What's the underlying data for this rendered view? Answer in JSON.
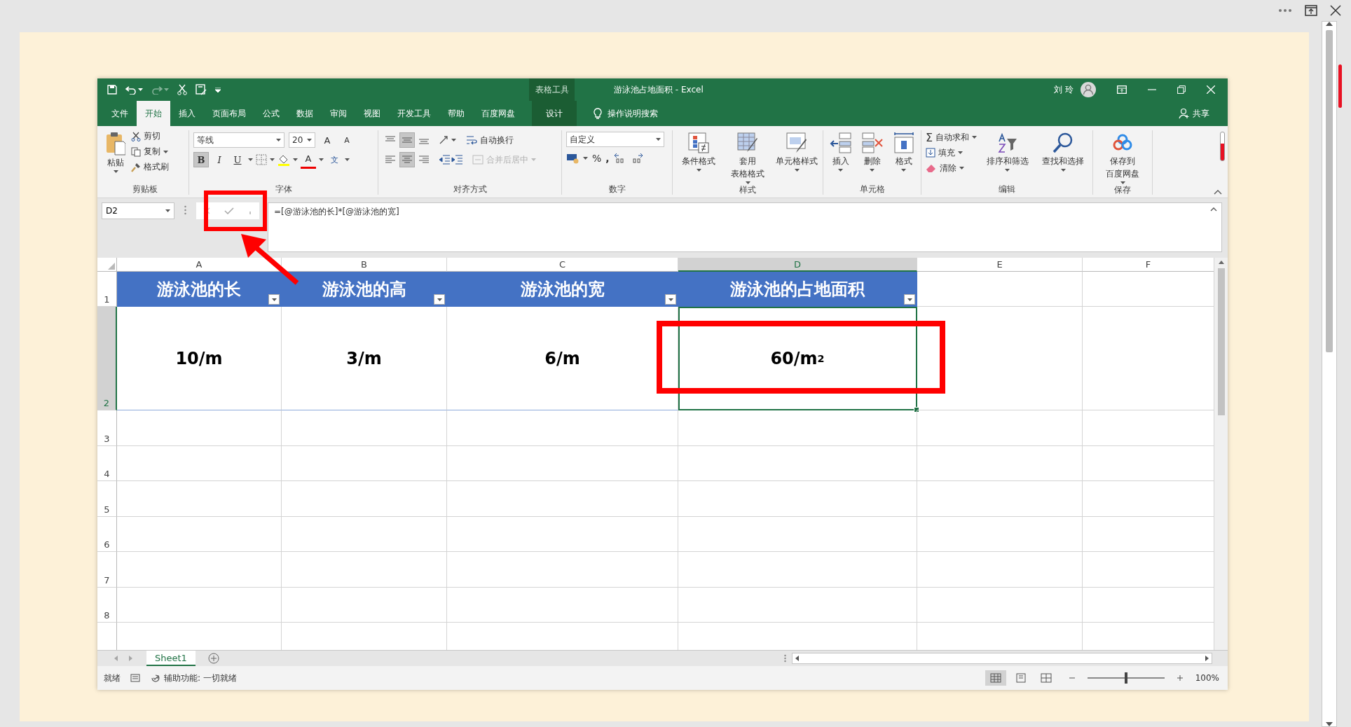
{
  "window": {
    "title": "游泳池占地面积  -  Excel",
    "tool_group": "表格工具",
    "user": "刘 玲"
  },
  "tabs": [
    {
      "label": "文件",
      "selected": false,
      "kind": "normal"
    },
    {
      "label": "开始",
      "selected": true,
      "kind": "normal"
    },
    {
      "label": "插入",
      "selected": false,
      "kind": "normal"
    },
    {
      "label": "页面布局",
      "selected": false,
      "kind": "normal"
    },
    {
      "label": "公式",
      "selected": false,
      "kind": "normal"
    },
    {
      "label": "数据",
      "selected": false,
      "kind": "normal"
    },
    {
      "label": "审阅",
      "selected": false,
      "kind": "normal"
    },
    {
      "label": "视图",
      "selected": false,
      "kind": "normal"
    },
    {
      "label": "开发工具",
      "selected": false,
      "kind": "normal"
    },
    {
      "label": "帮助",
      "selected": false,
      "kind": "normal"
    },
    {
      "label": "百度网盘",
      "selected": false,
      "kind": "normal"
    },
    {
      "label": "设计",
      "selected": false,
      "kind": "context"
    }
  ],
  "tell_me": "操作说明搜索",
  "share": "共享",
  "ribbon": [
    {
      "kind": "clipboard",
      "label": "剪贴板",
      "paste": "粘贴",
      "cut": "剪切",
      "copy": "复制",
      "format_painter": "格式刷"
    },
    {
      "kind": "font",
      "label": "字体",
      "font": "等线",
      "size": "20",
      "grow": "A",
      "shrink": "A",
      "bold": {
        "label": "B",
        "selected": true
      },
      "italic": {
        "label": "I",
        "selected": false
      },
      "underline": {
        "label": "U",
        "selected": false
      },
      "font_color": "A",
      "phonetic": "文"
    },
    {
      "kind": "alignment",
      "label": "对齐方式",
      "vertical": [
        {
          "selected": false
        },
        {
          "selected": true
        },
        {
          "selected": false
        }
      ],
      "horizontal": [
        {
          "selected": false
        },
        {
          "selected": true
        },
        {
          "selected": false
        }
      ],
      "wrap": "自动换行",
      "merge": {
        "label": "合并后居中",
        "disabled": true
      }
    },
    {
      "kind": "number",
      "label": "数字",
      "format": "自定义",
      "percent": "%",
      "comma": ","
    },
    {
      "kind": "large",
      "label": "样式",
      "buttons": [
        {
          "lines": [
            "条件格式"
          ],
          "kind": "conditional"
        },
        {
          "lines": [
            "套用",
            "表格格式"
          ],
          "kind": "table"
        },
        {
          "lines": [
            "单元格样式"
          ],
          "kind": "cellstyle"
        }
      ]
    },
    {
      "kind": "large",
      "label": "单元格",
      "buttons": [
        {
          "lines": [
            "插入"
          ],
          "kind": "insert"
        },
        {
          "lines": [
            "删除"
          ],
          "kind": "delete"
        },
        {
          "lines": [
            "格式"
          ],
          "kind": "format"
        }
      ]
    },
    {
      "kind": "editing",
      "label": "编辑",
      "sum_sign": "Σ",
      "small": [
        "自动求和",
        "填充",
        "清除"
      ],
      "buttons": [
        {
          "lines": [
            "排序和筛选"
          ],
          "kind": "sort"
        },
        {
          "lines": [
            "查找和选择"
          ],
          "kind": "find"
        }
      ]
    },
    {
      "kind": "large",
      "label": "保存",
      "buttons": [
        {
          "lines": [
            "保存到",
            "百度网盘"
          ],
          "kind": "cloud"
        }
      ]
    }
  ],
  "formula_bar": {
    "name_box": "D2",
    "formula": "=[@游泳池的长]*[@游泳池的宽]"
  },
  "columns": [
    {
      "label": "A",
      "selected": false
    },
    {
      "label": "B",
      "selected": false
    },
    {
      "label": "C",
      "selected": false
    },
    {
      "label": "D",
      "selected": true
    },
    {
      "label": "E",
      "selected": false
    },
    {
      "label": "F",
      "selected": false
    }
  ],
  "rows": [
    {
      "label": "1",
      "selected": false
    },
    {
      "label": "2",
      "selected": true
    },
    {
      "label": "3",
      "selected": false
    },
    {
      "label": "4",
      "selected": false
    },
    {
      "label": "5",
      "selected": false
    },
    {
      "label": "6",
      "selected": false
    },
    {
      "label": "7",
      "selected": false
    },
    {
      "label": "8",
      "selected": false
    }
  ],
  "table": {
    "headers": [
      "游泳池的长",
      "游泳池的高",
      "游泳池的宽",
      "游泳池的占地面积"
    ],
    "values": [
      "10/m",
      "3/m",
      "6/m",
      "60/m$^{2}$"
    ]
  },
  "sheet_tabs": [
    {
      "label": "Sheet1",
      "selected": true
    }
  ],
  "status_bar": {
    "ready": "就绪",
    "accessibility": "辅助功能: 一切就绪",
    "views": [
      {
        "selected": true
      },
      {
        "selected": false
      },
      {
        "selected": false
      }
    ],
    "zoom_slider": {
      "level": 0.5
    },
    "zoom": "100%"
  },
  "annotations": [
    {
      "kind": "box"
    },
    {
      "kind": "box"
    },
    {
      "kind": "arrow"
    }
  ]
}
